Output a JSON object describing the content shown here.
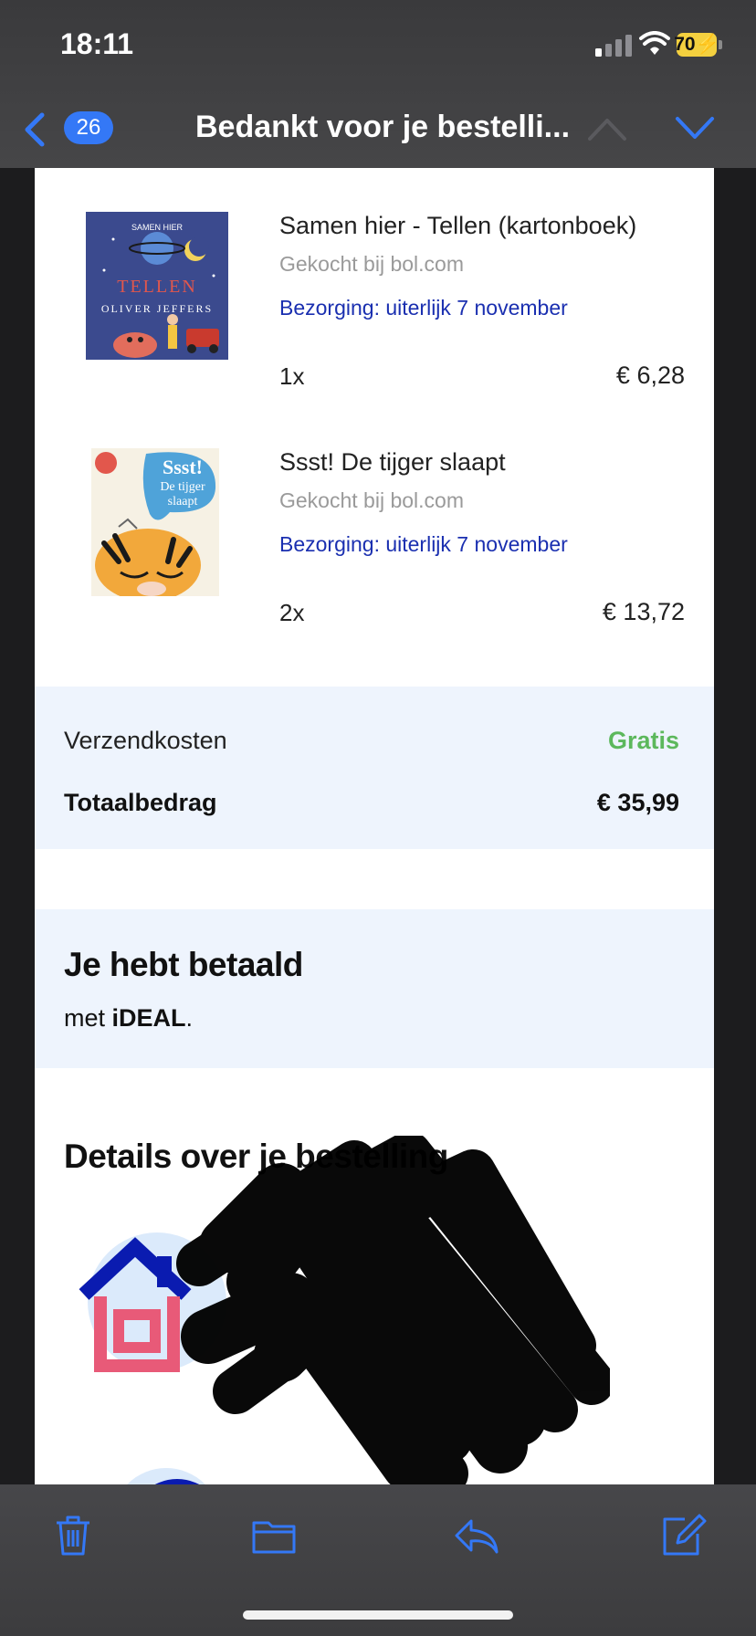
{
  "status_bar": {
    "time": "18:11",
    "battery": "70",
    "battery_color": "#f4d03f"
  },
  "nav": {
    "back_icon": "chevron-left-icon",
    "unread_count": "26",
    "title": "Bedankt voor je bestelli...",
    "prev_icon": "chevron-up-icon",
    "next_icon": "chevron-down-icon",
    "accent_color": "#3478f6"
  },
  "order": {
    "items": [
      {
        "title": "Samen hier - Tellen (kartonboek)",
        "seller": "Gekocht bij bol.com",
        "delivery": "Bezorging: uiterlijk 7 november",
        "quantity": "1x",
        "price": "€ 6,28",
        "cover_text": [
          "SAMEN HIER",
          "TELLEN",
          "OLIVER JEFFERS"
        ]
      },
      {
        "title": "Ssst! De tijger slaapt",
        "seller": "Gekocht bij bol.com",
        "delivery": "Bezorging: uiterlijk 7 november",
        "quantity": "2x",
        "price": "€ 13,72",
        "cover_text": [
          "Ssst!",
          "De tijger",
          "slaapt"
        ]
      }
    ],
    "shipping_label": "Verzendkosten",
    "shipping_value": "Gratis",
    "total_label": "Totaalbedrag",
    "total_value": "€ 35,99"
  },
  "payment": {
    "title": "Je hebt betaald",
    "text_prefix": "met ",
    "method": "iDEAL",
    "text_suffix": "."
  },
  "details": {
    "title": "Details over je bestelling"
  },
  "toolbar": {
    "icons": [
      "trash-icon",
      "folder-icon",
      "reply-icon",
      "compose-icon"
    ]
  }
}
